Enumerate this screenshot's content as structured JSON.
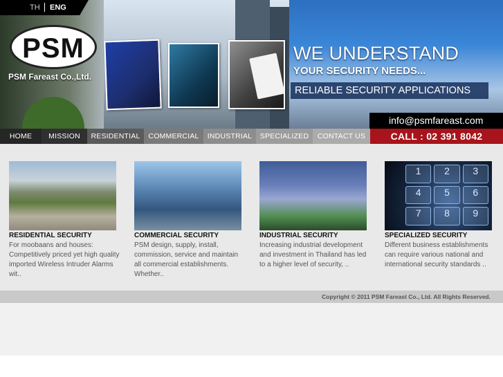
{
  "language": {
    "th": "TH",
    "en": "ENG"
  },
  "brand": {
    "logo_text": "PSM",
    "company": "PSM Fareast Co.,Ltd."
  },
  "banner": {
    "headline": "WE UNDERSTAND",
    "subhead": "YOUR SECURITY NEEDS...",
    "tagline": "RELIABLE SECURITY APPLICATIONS",
    "email": "info@psmfareast.com"
  },
  "nav": {
    "items": [
      "HOME",
      "MISSION",
      "RESIDENTIAL",
      "COMMERCIAL",
      "INDUSTRIAL",
      "SPECIALIZED",
      "CONTACT US"
    ],
    "call": "CALL : 02 391 8042"
  },
  "features": [
    {
      "title": "RESIDENTIAL SECURITY",
      "desc": "For moobaans and houses: Competitively priced yet high quality imported Wireless Intruder Alarms wit.."
    },
    {
      "title": "COMMERCIAL SECURITY",
      "desc": "PSM design, supply, install, commission, service and maintain all commercial establishments. Whether.."
    },
    {
      "title": "INDUSTRIAL SECURITY",
      "desc": "Increasing industrial development and investment in Thailand has led to a higher level of security, .."
    },
    {
      "title": "SPECIALIZED SECURITY",
      "desc": "Different business establishments can require various national and international security standards .."
    }
  ],
  "keypad": [
    "1",
    "2",
    "3",
    "4",
    "5",
    "6",
    "7",
    "8",
    "9"
  ],
  "copyright": "Copyright © 2011 PSM Fareast Co., Ltd. All Rights Reserved."
}
